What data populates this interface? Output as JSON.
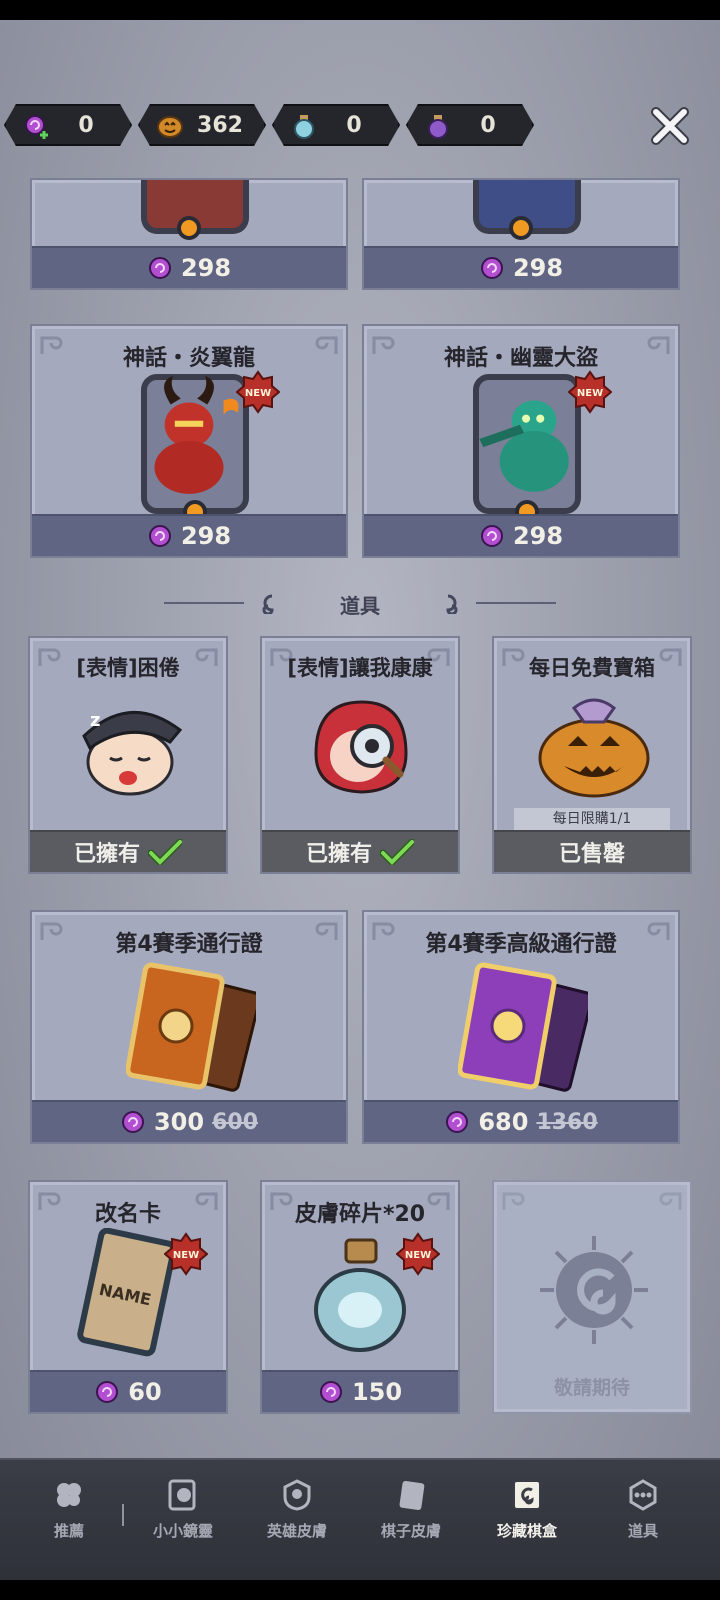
{
  "currency": [
    {
      "icon": "candy-plus-icon",
      "value": "0"
    },
    {
      "icon": "pumpkin-coin-icon",
      "value": "362"
    },
    {
      "icon": "blue-potion-icon",
      "value": "0"
    },
    {
      "icon": "purple-potion-icon",
      "value": "0"
    }
  ],
  "close_icon": "close-icon",
  "skins_top": [
    {
      "price": "298"
    },
    {
      "price": "298"
    }
  ],
  "skins": [
    {
      "title": "神話・炎翼龍",
      "badge": "NEW",
      "price": "298"
    },
    {
      "title": "神話・幽靈大盜",
      "badge": "NEW",
      "price": "298"
    }
  ],
  "section": {
    "title": "道具"
  },
  "items_row1": [
    {
      "title": "[表情]困倦",
      "status": "已擁有"
    },
    {
      "title": "[表情]讓我康康",
      "status": "已擁有"
    },
    {
      "title": "每日免費寶箱",
      "limit": "每日限購1/1",
      "status": "已售罄"
    }
  ],
  "passes": [
    {
      "title": "第4賽季通行證",
      "price": "300",
      "old_price": "600"
    },
    {
      "title": "第4賽季高級通行證",
      "price": "680",
      "old_price": "1360"
    }
  ],
  "items_row3": [
    {
      "title": "改名卡",
      "badge": "NEW",
      "price": "60",
      "card_text": "NAME"
    },
    {
      "title": "皮膚碎片*20",
      "badge": "NEW",
      "price": "150"
    },
    {
      "title": "",
      "status": "敬請期待"
    }
  ],
  "nav": [
    {
      "label": "推薦",
      "icon": "clover-icon"
    },
    {
      "label": "小小鏡靈",
      "icon": "ghost-card-icon"
    },
    {
      "label": "英雄皮膚",
      "icon": "hero-helmet-icon"
    },
    {
      "label": "棋子皮膚",
      "icon": "piece-card-icon"
    },
    {
      "label": "珍藏棋盒",
      "icon": "collection-box-icon",
      "active": true
    },
    {
      "label": "道具",
      "icon": "item-dots-icon"
    }
  ],
  "colors": {
    "accent_candy": "#b14fd0",
    "price_bar": "#5f6582",
    "owned_bar": "#5a5c62",
    "card_bg": "#a4a9be"
  }
}
